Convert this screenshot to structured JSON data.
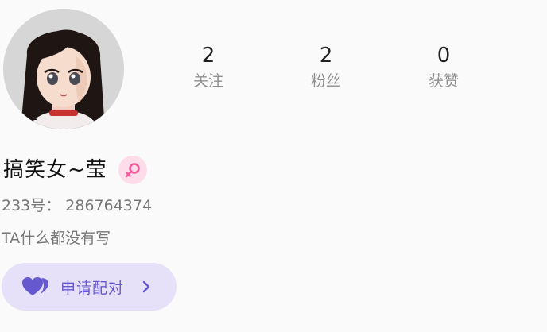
{
  "profile": {
    "nickname": "搞笑女~莹",
    "uid_label": "233号：",
    "uid": "286764374",
    "bio": "TA什么都没有写",
    "gender": "female",
    "avatar": "anime-girl-avatar"
  },
  "stats": {
    "following": {
      "value": "2",
      "label": "关注"
    },
    "fans": {
      "value": "2",
      "label": "粉丝"
    },
    "likes": {
      "value": "0",
      "label": "获赞"
    }
  },
  "actions": {
    "pair_label": "申请配对",
    "pair_icon": "heart-pair-icon",
    "chevron_icon": "chevron-right-icon"
  },
  "colors": {
    "background": "#fafafa",
    "pair_button_bg": "#e6e1f8",
    "pair_accent": "#6658cf",
    "gender_badge_bg": "#ffdcea",
    "gender_icon": "#f25c9b",
    "muted_text": "#8f8f8f"
  }
}
